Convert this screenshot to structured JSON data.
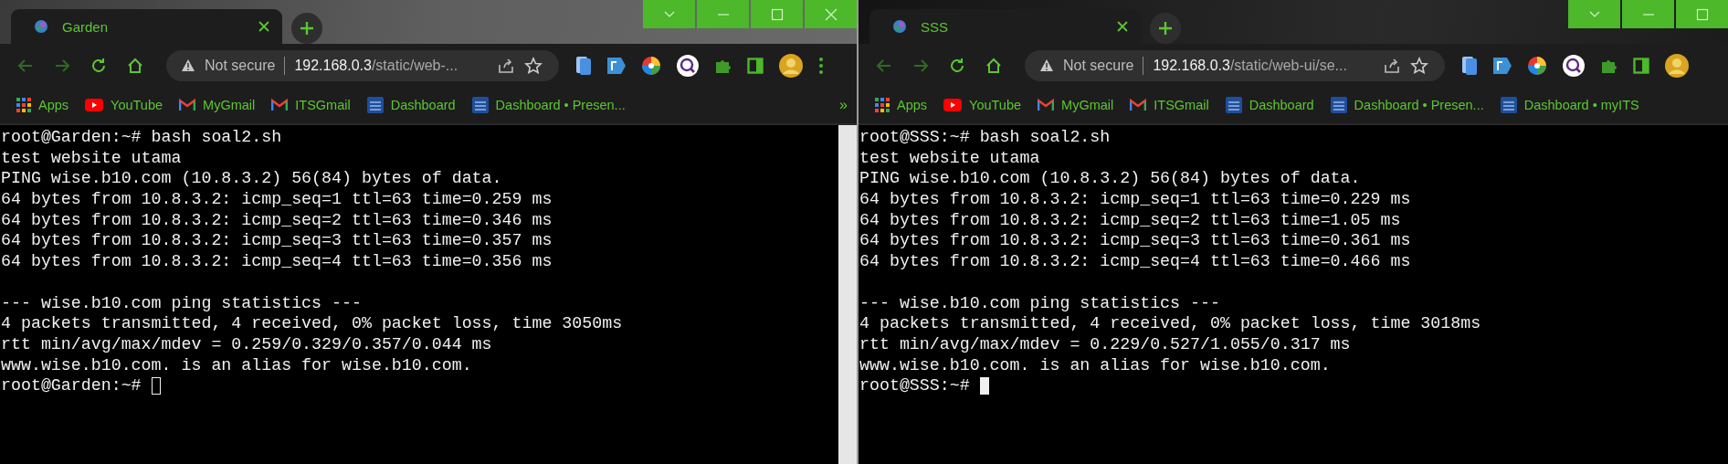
{
  "windows": [
    {
      "tab": {
        "title": "Garden"
      },
      "controls": [
        {
          "kind": "chevron"
        },
        {
          "kind": "minimize"
        },
        {
          "kind": "maximize"
        },
        {
          "kind": "close"
        }
      ],
      "address": {
        "security": "Not secure",
        "host": "192.168.0.3",
        "path": "/static/web-..."
      },
      "menu_button": true,
      "bookmarks": [
        {
          "kind": "apps",
          "label": "Apps"
        },
        {
          "kind": "youtube",
          "label": "YouTube"
        },
        {
          "kind": "gmail",
          "label": "MyGmail"
        },
        {
          "kind": "gmail",
          "label": "ITSGmail"
        },
        {
          "kind": "its",
          "label": "Dashboard"
        },
        {
          "kind": "its",
          "label": "Dashboard • Presen..."
        }
      ],
      "more": "»",
      "scrollbar": true,
      "terminal": {
        "focused": false,
        "blocks": [
          [
            "root@Garden:~# bash soal2.sh",
            "test website utama",
            "PING wise.b10.com (10.8.3.2) 56(84) bytes of data.",
            "64 bytes from 10.8.3.2: icmp_seq=1 ttl=63 time=0.259 ms",
            "64 bytes from 10.8.3.2: icmp_seq=2 ttl=63 time=0.346 ms",
            "64 bytes from 10.8.3.2: icmp_seq=3 ttl=63 time=0.357 ms",
            "64 bytes from 10.8.3.2: icmp_seq=4 ttl=63 time=0.356 ms"
          ],
          [
            "--- wise.b10.com ping statistics ---",
            "4 packets transmitted, 4 received, 0% packet loss, time 3050ms",
            "rtt min/avg/max/mdev = 0.259/0.329/0.357/0.044 ms",
            "www.wise.b10.com. is an alias for wise.b10.com."
          ]
        ],
        "prompt": "root@Garden:~#"
      }
    },
    {
      "tab": {
        "title": "SSS"
      },
      "controls": [
        {
          "kind": "chevron"
        },
        {
          "kind": "minimize"
        },
        {
          "kind": "maximize"
        }
      ],
      "address": {
        "security": "Not secure",
        "host": "192.168.0.3",
        "path": "/static/web-ui/se..."
      },
      "bookmarks": [
        {
          "kind": "apps",
          "label": "Apps"
        },
        {
          "kind": "youtube",
          "label": "YouTube"
        },
        {
          "kind": "gmail",
          "label": "MyGmail"
        },
        {
          "kind": "gmail",
          "label": "ITSGmail"
        },
        {
          "kind": "its",
          "label": "Dashboard"
        },
        {
          "kind": "its",
          "label": "Dashboard • Presen..."
        },
        {
          "kind": "its",
          "label": "Dashboard • myITS"
        }
      ],
      "terminal": {
        "focused": true,
        "blocks": [
          [
            "root@SSS:~# bash soal2.sh",
            "test website utama",
            "PING wise.b10.com (10.8.3.2) 56(84) bytes of data.",
            "64 bytes from 10.8.3.2: icmp_seq=1 ttl=63 time=0.229 ms",
            "64 bytes from 10.8.3.2: icmp_seq=2 ttl=63 time=1.05 ms",
            "64 bytes from 10.8.3.2: icmp_seq=3 ttl=63 time=0.361 ms",
            "64 bytes from 10.8.3.2: icmp_seq=4 ttl=63 time=0.466 ms"
          ],
          [
            "--- wise.b10.com ping statistics ---",
            "4 packets transmitted, 4 received, 0% packet loss, time 3018ms",
            "rtt min/avg/max/mdev = 0.229/0.527/1.055/0.317 ms",
            "www.wise.b10.com. is an alias for wise.b10.com."
          ]
        ],
        "prompt": "root@SSS:~#"
      }
    }
  ]
}
